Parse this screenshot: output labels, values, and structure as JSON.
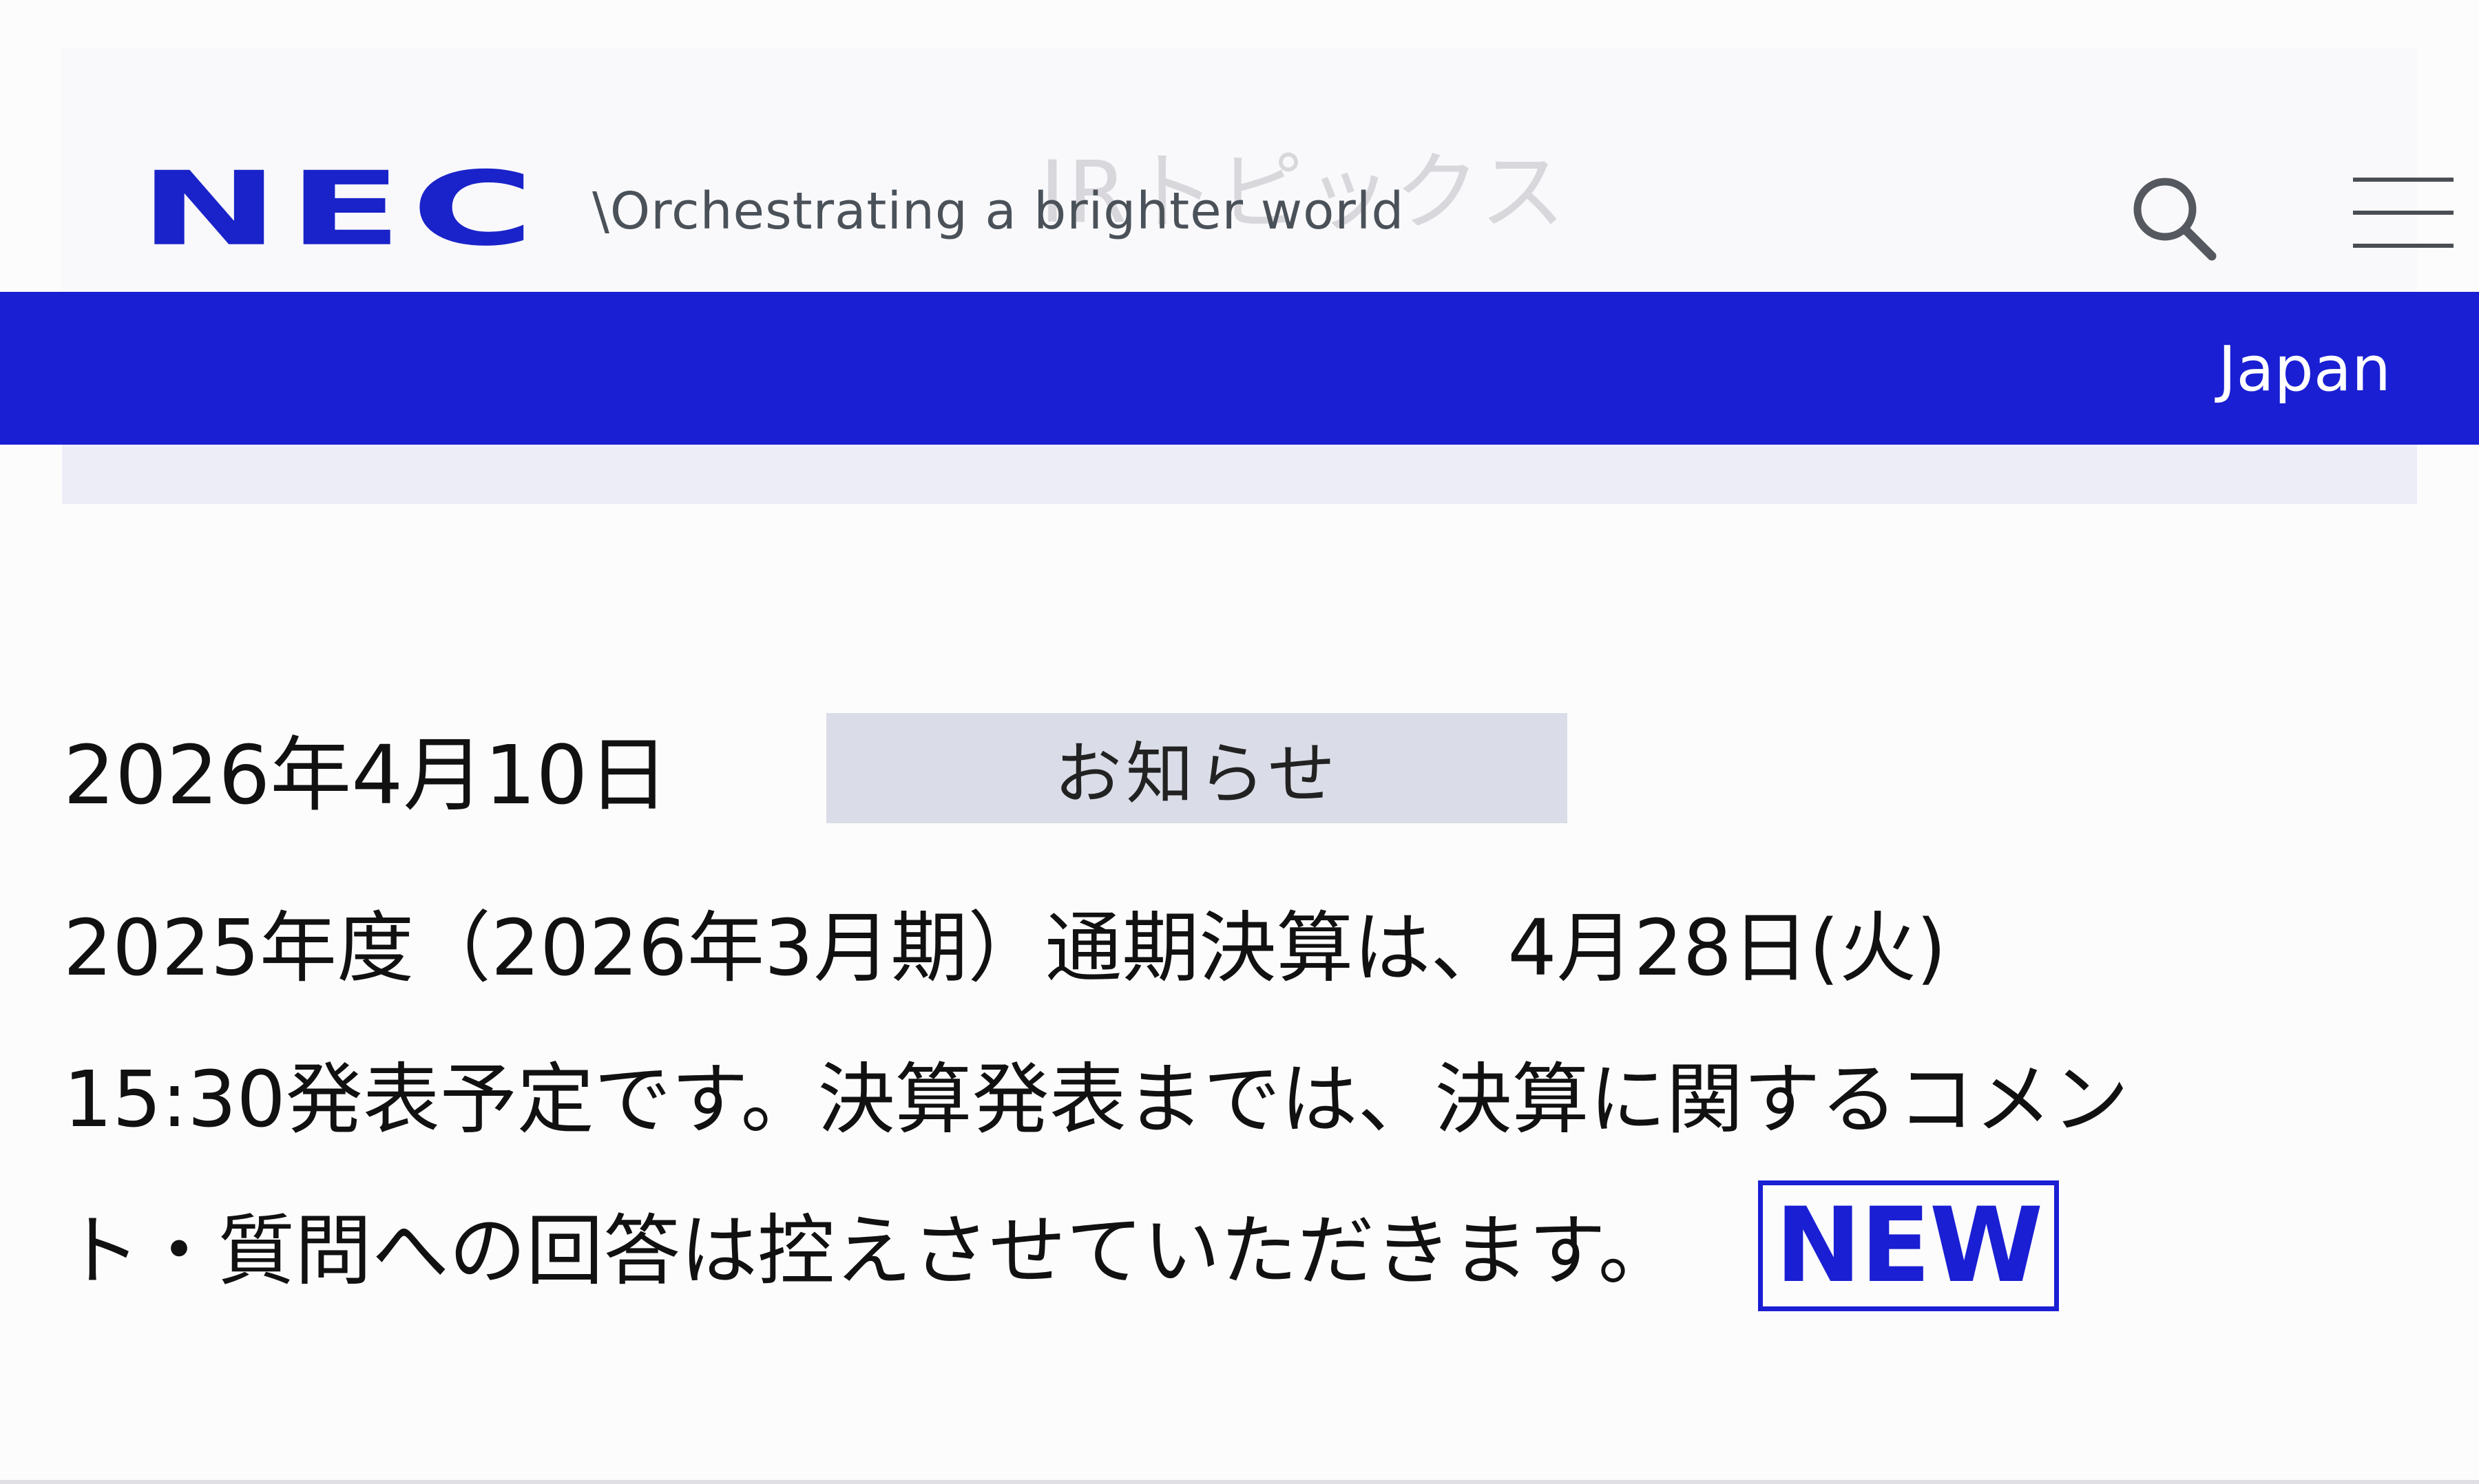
{
  "header": {
    "logo_text": "NEC",
    "tagline": "\\Orchestrating a brighter world",
    "page_title": "IRトピックス",
    "search_icon": "search-icon",
    "menu_icon": "hamburger-menu-icon"
  },
  "region_bar": {
    "region_label": "Japan"
  },
  "news": {
    "date": "2026年4月10日",
    "category": "お知らせ",
    "body_lines": [
      "2025年度（2026年3月期）通期決算は、4月28日(火)",
      "15:30発表予定です。決算発表までは、決算に関するコメン",
      "ト・質問への回答は控えさせていただきます。"
    ],
    "badge": "NEW"
  },
  "colors": {
    "brand_blue": "#1a1fd3",
    "tag_bg": "#dadde7",
    "strip_bg": "#ecedf6"
  }
}
